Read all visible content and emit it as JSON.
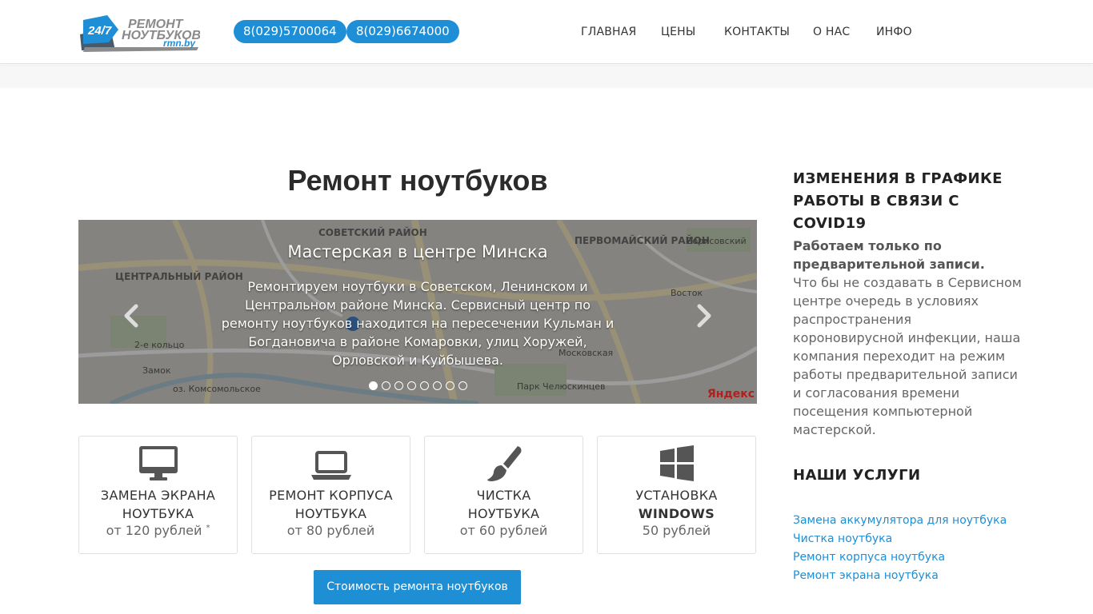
{
  "header": {
    "logo": {
      "badge": "24/7",
      "line1": "РЕМОНТ",
      "line2": "НОУТБУКОВ",
      "domain": "rmn.by"
    },
    "phones": [
      "8(029)5700064",
      "8(029)6674000"
    ],
    "nav": [
      "ГЛАВНАЯ",
      "ЦЕНЫ",
      "КОНТАКТЫ",
      "О НАС",
      "ИНФО"
    ]
  },
  "main": {
    "title": "Ремонт ноутбуков",
    "carousel": {
      "slide_title": "Мастерская в центре Минска",
      "slide_text": "Ремонтируем ноутбуки в Советском, Ленинском и Центральном районе Минска. Сервисный центр по ремонту ноутбуков находится на пересечении Кульман и Богдановича в районе Комаровки, улиц Хоружей, Орловской и Куйбышева.",
      "prev_label": "Previous",
      "next_label": "Next",
      "slide_count": 8,
      "active_slide": 1,
      "map_labels": [
        "СОВЕТСКИЙ РАЙОН",
        "ЦЕНТРАЛЬНЫЙ РАЙОН",
        "ПЕРВОМАЙСКИЙ РАЙОН",
        "2-е кольцо",
        "Замок",
        "оз. Комсомольское",
        "Парк Челюскинцев",
        "Московская",
        "Восток",
        "Борисовский"
      ],
      "map_brand": "Яндекс"
    },
    "services": [
      {
        "icon": "monitor-icon",
        "title_l1": "ЗАМЕНА ЭКРАНА",
        "title_l2": "НОУТБУКА",
        "price": "от 120 рублей",
        "footnote": "*"
      },
      {
        "icon": "laptop-icon",
        "title_l1": "РЕМОНТ КОРПУСА",
        "title_l2": "НОУТБУКА",
        "price": "от 80 рублей"
      },
      {
        "icon": "brush-icon",
        "title_l1": "ЧИСТКА",
        "title_l2": "НОУТБУКА",
        "price": "от 60 рублей"
      },
      {
        "icon": "windows-icon",
        "title_l1": "УСТАНОВКА",
        "title_l2": "WINDOWS",
        "price": "50 рублей"
      }
    ],
    "cta_label": "Стоимость ремонта ноутбуков"
  },
  "sidebar": {
    "notice_heading_part1": "ИЗМЕНЕНИЯ В ГРАФИКЕ РАБОТЫ В СВЯЗИ С",
    "notice_heading_part2": "COVID19",
    "notice_bold": "Работаем только по предварительной записи.",
    "notice_text": "Что бы не создавать в Сервисном центре очередь в условиях распространения короновирусной инфекции, наша компания переходит на режим работы предварительной записи и согласования времени посещения компьютерной мастерской.",
    "services_heading": "НАШИ УСЛУГИ",
    "service_links": [
      "Замена аккумулятора для ноутбука",
      "Чистка ноутбука",
      "Ремонт корпуса ноутбука",
      "Ремонт экрана ноутбука"
    ]
  },
  "colors": {
    "accent": "#1e8fd6",
    "text": "#333333",
    "muted": "#666666"
  }
}
